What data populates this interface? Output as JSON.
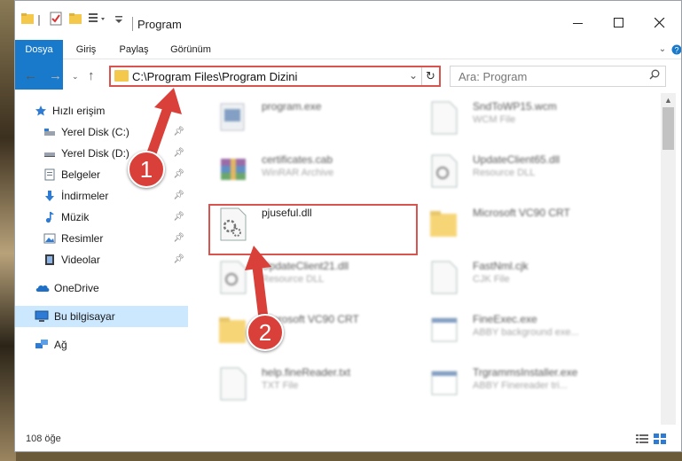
{
  "window": {
    "title": "Program"
  },
  "ribbon": {
    "tabs": [
      "Dosya",
      "Giriş",
      "Paylaş",
      "Görünüm"
    ]
  },
  "nav": {
    "address": "C:\\Program Files\\Program Dizini",
    "search_placeholder": "Ara: Program"
  },
  "sidebar": {
    "items": [
      {
        "label": "Hızlı erişim",
        "icon": "star-icon"
      },
      {
        "label": "Yerel Disk (C:)",
        "icon": "drive-icon"
      },
      {
        "label": "Yerel Disk (D:)",
        "icon": "drive-icon"
      },
      {
        "label": "Belgeler",
        "icon": "documents-icon"
      },
      {
        "label": "İndirmeler",
        "icon": "download-icon"
      },
      {
        "label": "Müzik",
        "icon": "music-icon"
      },
      {
        "label": "Resimler",
        "icon": "pictures-icon"
      },
      {
        "label": "Videolar",
        "icon": "video-icon"
      },
      {
        "label": "OneDrive",
        "icon": "cloud-icon"
      },
      {
        "label": "Bu bilgisayar",
        "icon": "computer-icon"
      },
      {
        "label": "Ağ",
        "icon": "network-icon"
      }
    ]
  },
  "files": {
    "left": [
      {
        "name": "program.exe",
        "type": ""
      },
      {
        "name": "certificates.cab",
        "type": "WinRAR Archive"
      },
      {
        "name": "pjuseful.dll",
        "type": ""
      },
      {
        "name": "UpdateClient21.dll",
        "type": "Resource DLL"
      },
      {
        "name": "Microsoft VC90 CRT",
        "type": ""
      },
      {
        "name": "help.fineReader.txt",
        "type": "TXT File"
      }
    ],
    "right": [
      {
        "name": "SndToWP15.wcm",
        "type": "WCM File"
      },
      {
        "name": "UpdateClient65.dll",
        "type": "Resource DLL"
      },
      {
        "name": "Microsoft VC90 CRT",
        "type": ""
      },
      {
        "name": "FastNml.cjk",
        "type": "CJK File"
      },
      {
        "name": "FineExec.exe",
        "type": "ABBY background exe..."
      },
      {
        "name": "TrgrammsInstaller.exe",
        "type": "ABBY Finereader tri..."
      }
    ]
  },
  "status": {
    "count": "108 öğe"
  },
  "annotations": {
    "step1": "1",
    "step2": "2",
    "color": "#d9403a"
  }
}
